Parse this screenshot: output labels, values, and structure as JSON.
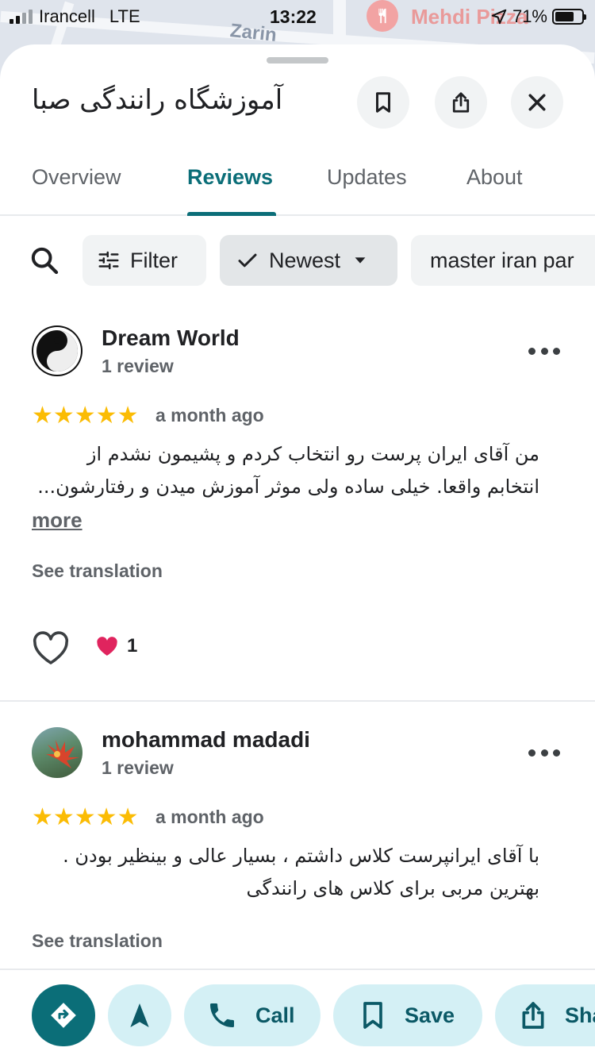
{
  "status_bar": {
    "carrier": "Irancell",
    "network": "LTE",
    "time": "13:22",
    "battery": "71%",
    "battery_level": 0.71
  },
  "map": {
    "street_label": "Zarin",
    "poi_label": "Mehdi Pizza"
  },
  "place": {
    "title": "آموزشگاه رانندگی صبا"
  },
  "tabs": [
    {
      "label": "Overview"
    },
    {
      "label": "Reviews",
      "active": true
    },
    {
      "label": "Updates"
    },
    {
      "label": "About"
    }
  ],
  "filters": {
    "filter_label": "Filter",
    "sort_label": "Newest",
    "topic_chip": "master iran par"
  },
  "reviews": [
    {
      "name": "Dream World",
      "count": "1 review",
      "stars": "★★★★★",
      "rating": 5,
      "time": "a month ago",
      "text": "من آقای ایران پرست رو انتخاب کردم و پشیمون نشدم از انتخابم واقعا. خیلی ساده ولی موثر آموزش میدن و رفتارشون...",
      "more": "more",
      "translate": "See translation",
      "reaction_count": "1"
    },
    {
      "name": "mohammad madadi",
      "count": "1 review",
      "stars": "★★★★★",
      "rating": 5,
      "time": "a month ago",
      "text": "با آقای ایرانپرست کلاس داشتم ، بسیار عالی و بینظیر بودن . بهترین مربی برای کلاس های رانندگی",
      "translate": "See translation"
    }
  ],
  "actions": {
    "call": "Call",
    "save": "Save",
    "share": "Share"
  },
  "colors": {
    "accent": "#0b6e78",
    "action_bg": "#d4f0f5",
    "star": "#fbbc04"
  }
}
